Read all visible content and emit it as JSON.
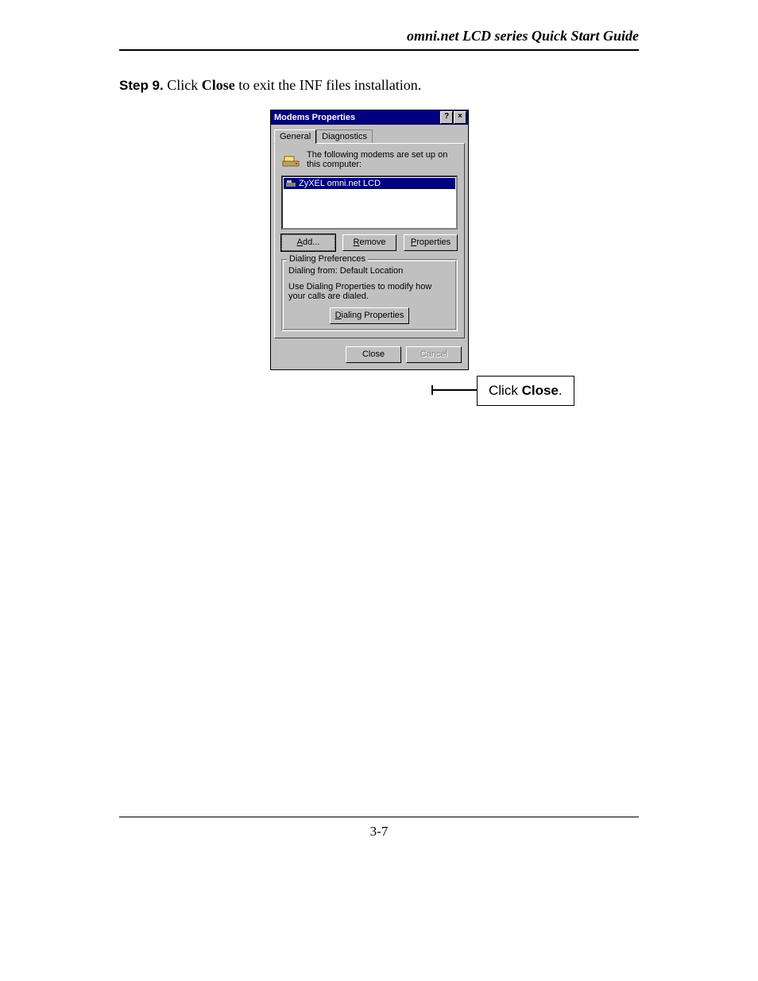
{
  "header": {
    "title": "omni.net LCD series Quick Start Guide"
  },
  "step": {
    "label": "Step 9.",
    "text_before": " Click ",
    "bold_word": "Close",
    "text_after": " to exit the INF files installation."
  },
  "dialog": {
    "title": "Modems Properties",
    "help_glyph": "?",
    "close_glyph": "×",
    "tabs": {
      "general": "General",
      "diagnostics": "Diagnostics"
    },
    "intro": "The following modems are set up on this computer:",
    "list_item": "ZyXEL omni.net LCD",
    "buttons": {
      "add": "Add...",
      "add_u": "A",
      "remove": "Remove",
      "remove_u": "R",
      "properties": "Properties",
      "properties_u": "P"
    },
    "group": {
      "title": "Dialing Preferences",
      "line1": "Dialing from:  Default Location",
      "line2": "Use Dialing Properties to modify how your calls are dialed.",
      "btn": "Dialing Properties",
      "btn_u": "D"
    },
    "footer": {
      "close": "Close",
      "cancel": "Cancel"
    }
  },
  "callout": {
    "prefix": "Click ",
    "bold": "Close",
    "suffix": "."
  },
  "footer": {
    "page": "3-7"
  }
}
